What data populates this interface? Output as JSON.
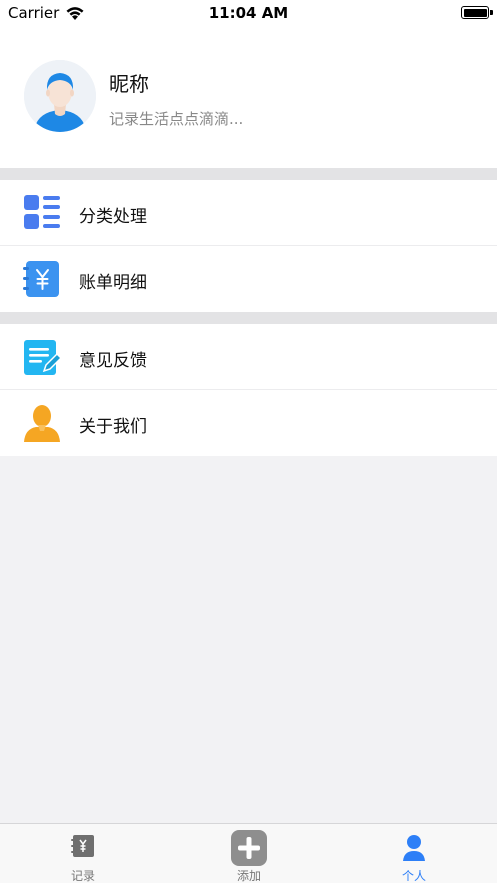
{
  "status_bar": {
    "carrier": "Carrier",
    "time": "11:04 AM"
  },
  "profile": {
    "nickname": "昵称",
    "bio": "记录生活点点滴滴..."
  },
  "menu_groups": [
    {
      "items": [
        {
          "label": "分类处理",
          "icon": "category-grid-icon"
        },
        {
          "label": "账单明细",
          "icon": "bill-notebook-icon"
        }
      ]
    },
    {
      "items": [
        {
          "label": "意见反馈",
          "icon": "feedback-note-icon"
        },
        {
          "label": "关于我们",
          "icon": "person-silhouette-icon"
        }
      ]
    }
  ],
  "tab_bar": {
    "tabs": [
      {
        "label": "记录",
        "icon": "record-book-icon",
        "active": false
      },
      {
        "label": "添加",
        "icon": "add-plus-icon",
        "active": false
      },
      {
        "label": "个人",
        "icon": "person-icon",
        "active": true
      }
    ]
  },
  "colors": {
    "accent": "#2d7ff7",
    "category_icon": "#4a7cef",
    "bill_icon": "#3b93f0",
    "feedback_icon": "#23b6f1",
    "about_icon": "#f5a623",
    "avatar_shirt": "#1e88e5",
    "separator": "#e3e3e5",
    "background": "#f2f2f4"
  }
}
